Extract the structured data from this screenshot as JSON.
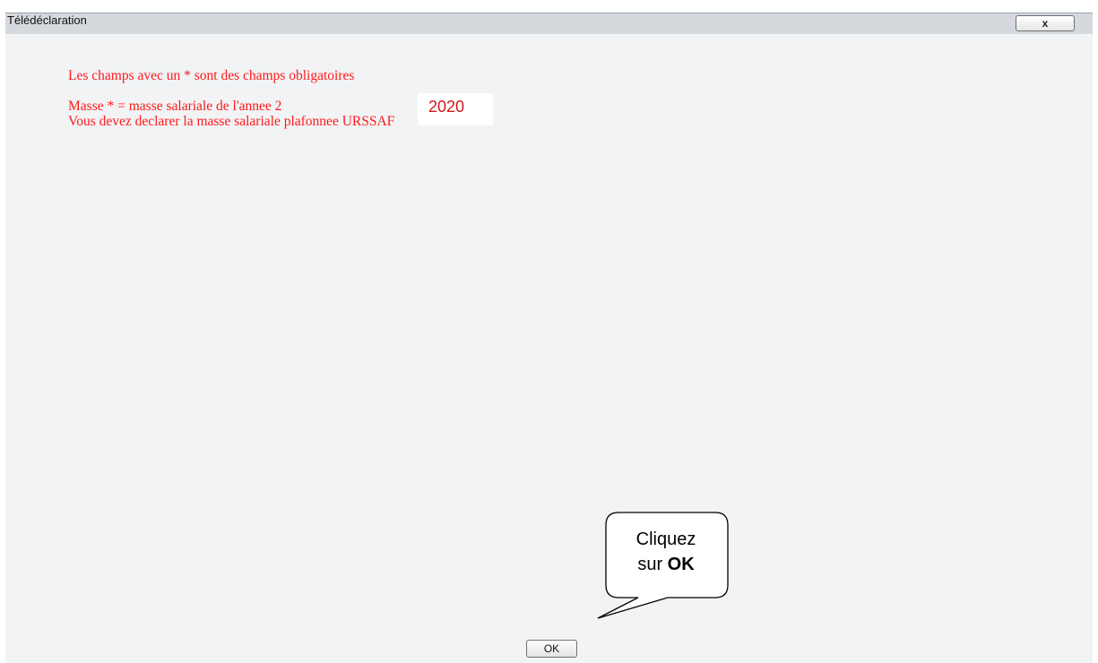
{
  "window": {
    "title": "Télédéclaration",
    "close_label": "x"
  },
  "messages": {
    "required_fields": "Les champs avec un * sont des champs obligatoires",
    "masse_line": "Masse * = masse salariale de l'annee 2",
    "year": "2020",
    "plafonnee_line": "Vous devez declarer la masse salariale plafonnee URSSAF"
  },
  "buttons": {
    "ok_label": "OK"
  },
  "callout": {
    "line1": "Cliquez",
    "line2_prefix": "sur ",
    "line2_bold": "OK"
  },
  "colors": {
    "message_text": "#ff1a1a",
    "year_text": "#d01818",
    "dialog_background": "#f2f3f5",
    "titlebar_background": "#d5d9dd"
  }
}
